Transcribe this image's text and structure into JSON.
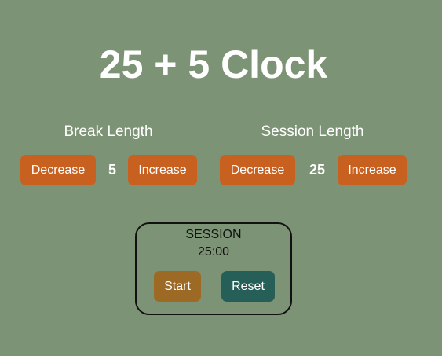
{
  "app": {
    "title": "25 + 5 Clock"
  },
  "break": {
    "label": "Break Length",
    "decrease_label": "Decrease",
    "increase_label": "Increase",
    "value": "5"
  },
  "session": {
    "label": "Session Length",
    "decrease_label": "Decrease",
    "increase_label": "Increase",
    "value": "25"
  },
  "timer": {
    "label": "SESSION",
    "time": "25:00",
    "start_label": "Start",
    "reset_label": "Reset"
  },
  "colors": {
    "background": "#7d9375",
    "adjust_button": "#c8611f",
    "start_button": "#9c6a24",
    "reset_button": "#255f58",
    "text_light": "#ffffff",
    "text_dark": "#111111"
  }
}
